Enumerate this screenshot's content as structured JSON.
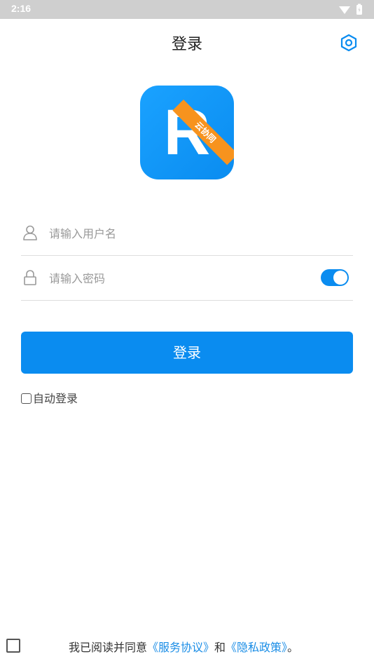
{
  "status_bar": {
    "time": "2:16",
    "icons": [
      "wifi-icon",
      "battery-icon"
    ]
  },
  "header": {
    "title": "登录",
    "settings_icon": "gear-hexagon-icon"
  },
  "logo": {
    "letter": "R",
    "ribbon_text": "云协同",
    "colors": {
      "primary": "#0a8cf0",
      "ribbon": "#f7931e"
    }
  },
  "form": {
    "username": {
      "placeholder": "请输入用户名",
      "value": "",
      "icon": "user-icon"
    },
    "password": {
      "placeholder": "请输入密码",
      "value": "",
      "icon": "lock-icon",
      "show_password_toggle": true
    },
    "login_button": "登录",
    "auto_login": {
      "label": "自动登录",
      "checked": false
    }
  },
  "agreement": {
    "prefix": "我已阅读并同意",
    "terms_link": "《服务协议》",
    "and_text": "和",
    "privacy_link": "《隐私政策》",
    "suffix": "。",
    "checked": false
  },
  "colors": {
    "accent": "#0a8cf0",
    "link": "#1a8de6"
  }
}
